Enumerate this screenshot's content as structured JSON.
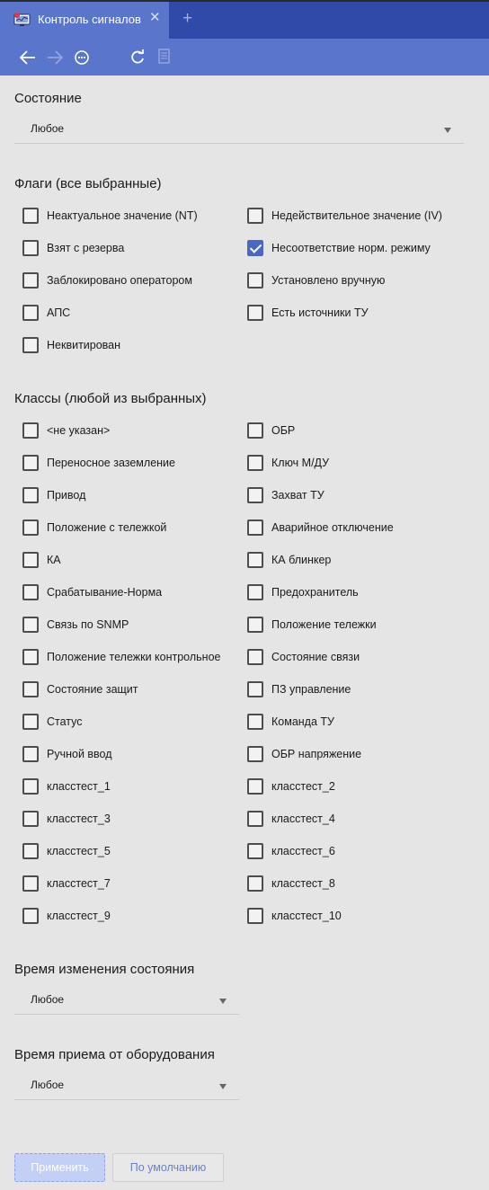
{
  "tab": {
    "title": "Контроль сигналов",
    "close": "✕",
    "add": "+"
  },
  "state": {
    "title": "Состояние",
    "value": "Любое"
  },
  "flags": {
    "title": "Флаги (все выбранные)",
    "left": [
      {
        "label": "Неактуальное значение (NT)",
        "checked": false
      },
      {
        "label": "Взят с резерва",
        "checked": false
      },
      {
        "label": "Заблокировано оператором",
        "checked": false
      },
      {
        "label": "АПС",
        "checked": false
      },
      {
        "label": "Неквитирован",
        "checked": false
      }
    ],
    "right": [
      {
        "label": "Недействительное значение (IV)",
        "checked": false
      },
      {
        "label": "Несоответствие норм. режиму",
        "checked": true
      },
      {
        "label": "Установлено вручную",
        "checked": false
      },
      {
        "label": "Есть источники ТУ",
        "checked": false
      }
    ]
  },
  "classes": {
    "title": "Классы (любой из выбранных)",
    "left": [
      {
        "label": "<не указан>",
        "checked": false
      },
      {
        "label": "Переносное заземление",
        "checked": false
      },
      {
        "label": "Привод",
        "checked": false
      },
      {
        "label": "Положение с тележкой",
        "checked": false
      },
      {
        "label": "КА",
        "checked": false
      },
      {
        "label": "Срабатывание-Норма",
        "checked": false
      },
      {
        "label": "Связь по SNMP",
        "checked": false
      },
      {
        "label": "Положение тележки контрольное",
        "checked": false
      },
      {
        "label": "Состояние защит",
        "checked": false
      },
      {
        "label": "Статус",
        "checked": false
      },
      {
        "label": "Ручной ввод",
        "checked": false
      },
      {
        "label": "класстест_1",
        "checked": false
      },
      {
        "label": "класстест_3",
        "checked": false
      },
      {
        "label": "класстест_5",
        "checked": false
      },
      {
        "label": "класстест_7",
        "checked": false
      },
      {
        "label": "класстест_9",
        "checked": false
      }
    ],
    "right": [
      {
        "label": "ОБР",
        "checked": false
      },
      {
        "label": "Ключ М/ДУ",
        "checked": false
      },
      {
        "label": "Захват ТУ",
        "checked": false
      },
      {
        "label": "Аварийное отключение",
        "checked": false
      },
      {
        "label": "КА блинкер",
        "checked": false
      },
      {
        "label": "Предохранитель",
        "checked": false
      },
      {
        "label": "Положение тележки",
        "checked": false
      },
      {
        "label": "Состояние связи",
        "checked": false
      },
      {
        "label": "ПЗ управление",
        "checked": false
      },
      {
        "label": "Команда ТУ",
        "checked": false
      },
      {
        "label": "ОБР напряжение",
        "checked": false
      },
      {
        "label": "класстест_2",
        "checked": false
      },
      {
        "label": "класстест_4",
        "checked": false
      },
      {
        "label": "класстест_6",
        "checked": false
      },
      {
        "label": "класстест_8",
        "checked": false
      },
      {
        "label": "класстест_10",
        "checked": false
      }
    ]
  },
  "change_time": {
    "title": "Время изменения состояния",
    "value": "Любое"
  },
  "receive_time": {
    "title": "Время приема от оборудования",
    "value": "Любое"
  },
  "buttons": {
    "apply": "Применить",
    "default": "По умолчанию"
  },
  "colors": {
    "accent": "#5a76cc",
    "tabbar": "#2f4aa8",
    "checked": "#4b67c4",
    "background": "#e5e5e5"
  }
}
